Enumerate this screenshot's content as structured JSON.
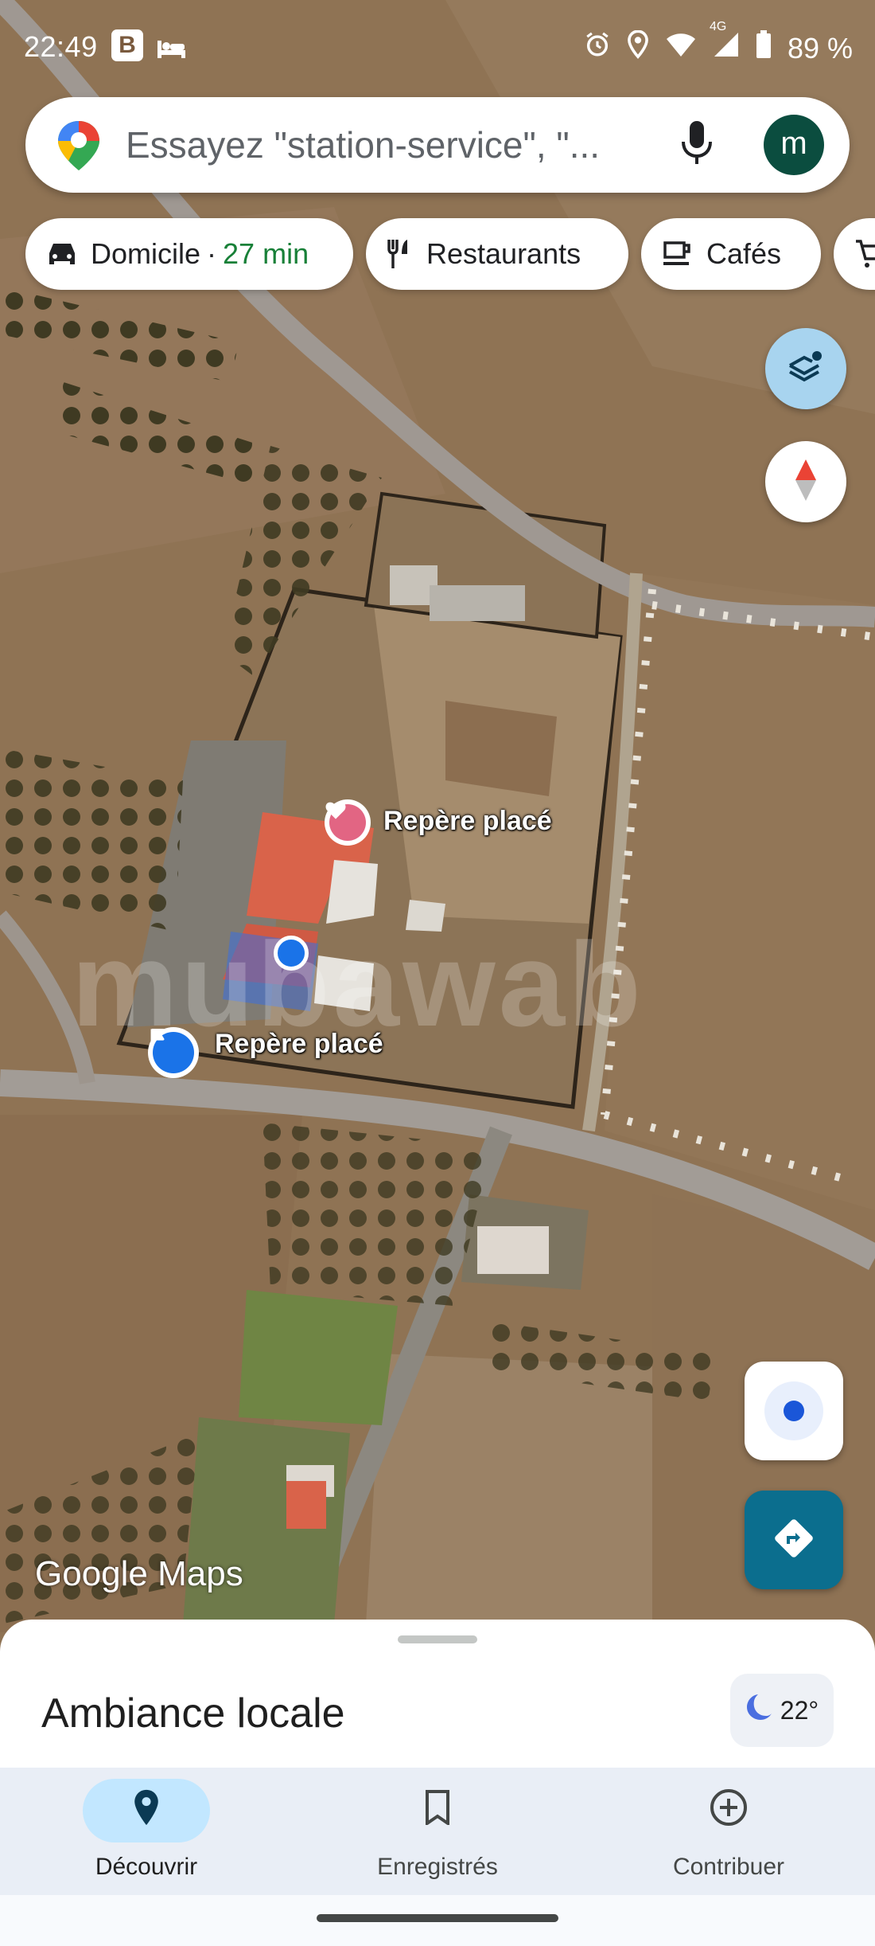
{
  "status_bar": {
    "time": "22:49",
    "app_badge": "B",
    "battery": "89 %",
    "network": "4G"
  },
  "search": {
    "placeholder": "Essayez \"station-service\", \"...",
    "avatar_letter": "m"
  },
  "chips": [
    {
      "label": "Domicile",
      "separator": "·",
      "eta": "27 min",
      "icon": "car-icon"
    },
    {
      "label": "Restaurants",
      "icon": "fork-knife-icon"
    },
    {
      "label": "Cafés",
      "icon": "coffee-cup-icon"
    },
    {
      "label": "",
      "icon": "cart-icon"
    }
  ],
  "map": {
    "markers": [
      {
        "label": "Repère placé",
        "icon": "heart-marker-icon"
      },
      {
        "label": "Repère placé",
        "icon": "flag-marker-icon"
      }
    ],
    "watermark": "mubawab",
    "attribution": "Google Maps",
    "colors": {
      "terrain": "#8a6f52",
      "road": "#a09a93",
      "roof": "#d9634a",
      "location": "#1a73e8"
    }
  },
  "bottom_sheet": {
    "title": "Ambiance locale",
    "weather_temp": "22°"
  },
  "nav": [
    {
      "label": "Découvrir",
      "icon": "location-pin-icon",
      "active": true
    },
    {
      "label": "Enregistrés",
      "icon": "bookmark-icon",
      "active": false
    },
    {
      "label": "Contribuer",
      "icon": "add-circle-icon",
      "active": false
    }
  ],
  "colors": {
    "accent": "#1a73e8",
    "eta_green": "#188038",
    "directions_fab": "#0b6e8e",
    "avatar": "#0b4d3f",
    "active_nav": "#c2e7ff"
  }
}
